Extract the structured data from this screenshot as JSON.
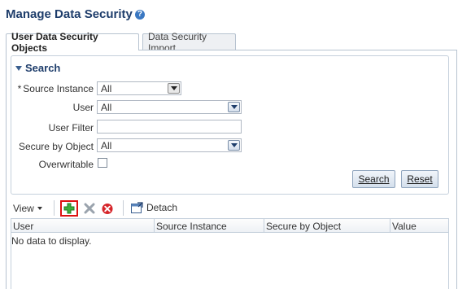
{
  "page": {
    "title": "Manage Data Security",
    "help_icon": "?"
  },
  "tabs": [
    {
      "label": "User Data Security Objects",
      "active": true
    },
    {
      "label": "Data Security Import",
      "active": false
    }
  ],
  "search": {
    "header": "Search",
    "fields": {
      "source_instance": {
        "label": "Source Instance",
        "required_marker": "*",
        "value": "All"
      },
      "user": {
        "label": "User",
        "value": "All"
      },
      "user_filter": {
        "label": "User Filter",
        "value": ""
      },
      "secure_by_object": {
        "label": "Secure by Object",
        "value": "All"
      },
      "overwritable": {
        "label": "Overwritable",
        "checked": false
      }
    },
    "search_button": "Search",
    "reset_button": "Reset"
  },
  "toolbar": {
    "view_label": "View",
    "detach_label": "Detach",
    "icons": [
      "add-icon",
      "delete-icon",
      "cancel-icon",
      "detach-icon"
    ]
  },
  "table": {
    "columns": [
      "User",
      "Source Instance",
      "Secure by Object",
      "Value"
    ],
    "empty_message": "No data to display."
  },
  "colors": {
    "title": "#1e3d6b",
    "accent": "#3a78c2",
    "add_highlight": "#dd1111"
  }
}
